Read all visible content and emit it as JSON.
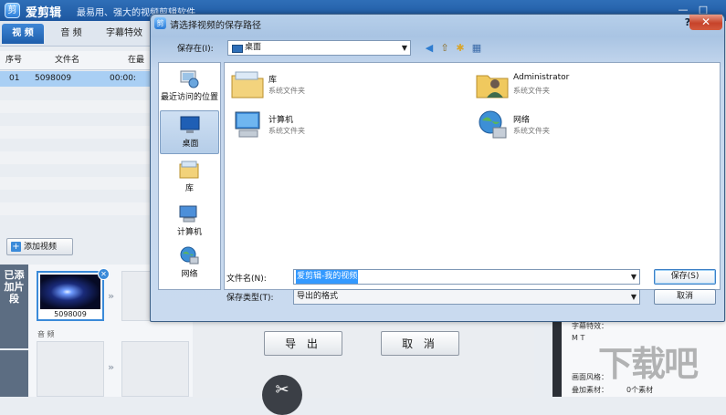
{
  "app": {
    "logo": "剪",
    "name": "爱剪辑",
    "slogan": "最易用、强大的视频剪辑软件",
    "min": "—",
    "max": "□"
  },
  "tabs": [
    {
      "label": "视 频"
    },
    {
      "label": "音 频"
    },
    {
      "label": "字幕特效"
    }
  ],
  "list": {
    "columns": [
      "序号",
      "文件名",
      "在最"
    ],
    "rows": [
      {
        "index": "01",
        "name": "5098009",
        "time": "00:00:"
      }
    ]
  },
  "add_video_button": "添加视频",
  "added_label": "已添加片段",
  "clip": {
    "name": "5098009"
  },
  "audio_label": "音 频",
  "export_button": "导 出",
  "cancel_button": "取 消",
  "right_panel": {
    "line1": "字幕特效：",
    "line2": "M  T",
    "line3": "画面风格：",
    "line4": "叠加素材：",
    "count": "0个素材"
  },
  "watermark": "下载吧",
  "dialog": {
    "title": "请选择视频的保存路径",
    "close": "✕",
    "help": "?",
    "save_in_label": "保存在(I):",
    "save_in_value": "桌面",
    "places": [
      {
        "label": "最近访问的位置",
        "icon": "recent-places-icon"
      },
      {
        "label": "桌面",
        "icon": "desktop-icon",
        "selected": true
      },
      {
        "label": "库",
        "icon": "libraries-icon"
      },
      {
        "label": "计算机",
        "icon": "computer-icon"
      },
      {
        "label": "网络",
        "icon": "network-icon"
      }
    ],
    "items": [
      {
        "name": "库",
        "type": "系统文件夹",
        "icon": "libraries-folder-icon"
      },
      {
        "name": "Administrator",
        "type": "系统文件夹",
        "icon": "user-folder-icon"
      },
      {
        "name": "计算机",
        "type": "系统文件夹",
        "icon": "computer-icon"
      },
      {
        "name": "网络",
        "type": "系统文件夹",
        "icon": "network-icon"
      }
    ],
    "filename_label": "文件名(N):",
    "filename_value": "爱剪辑-我的视频",
    "filetype_label": "保存类型(T):",
    "filetype_value": "导出的格式",
    "save_button": "保存(S)",
    "cancel_button": "取消"
  }
}
